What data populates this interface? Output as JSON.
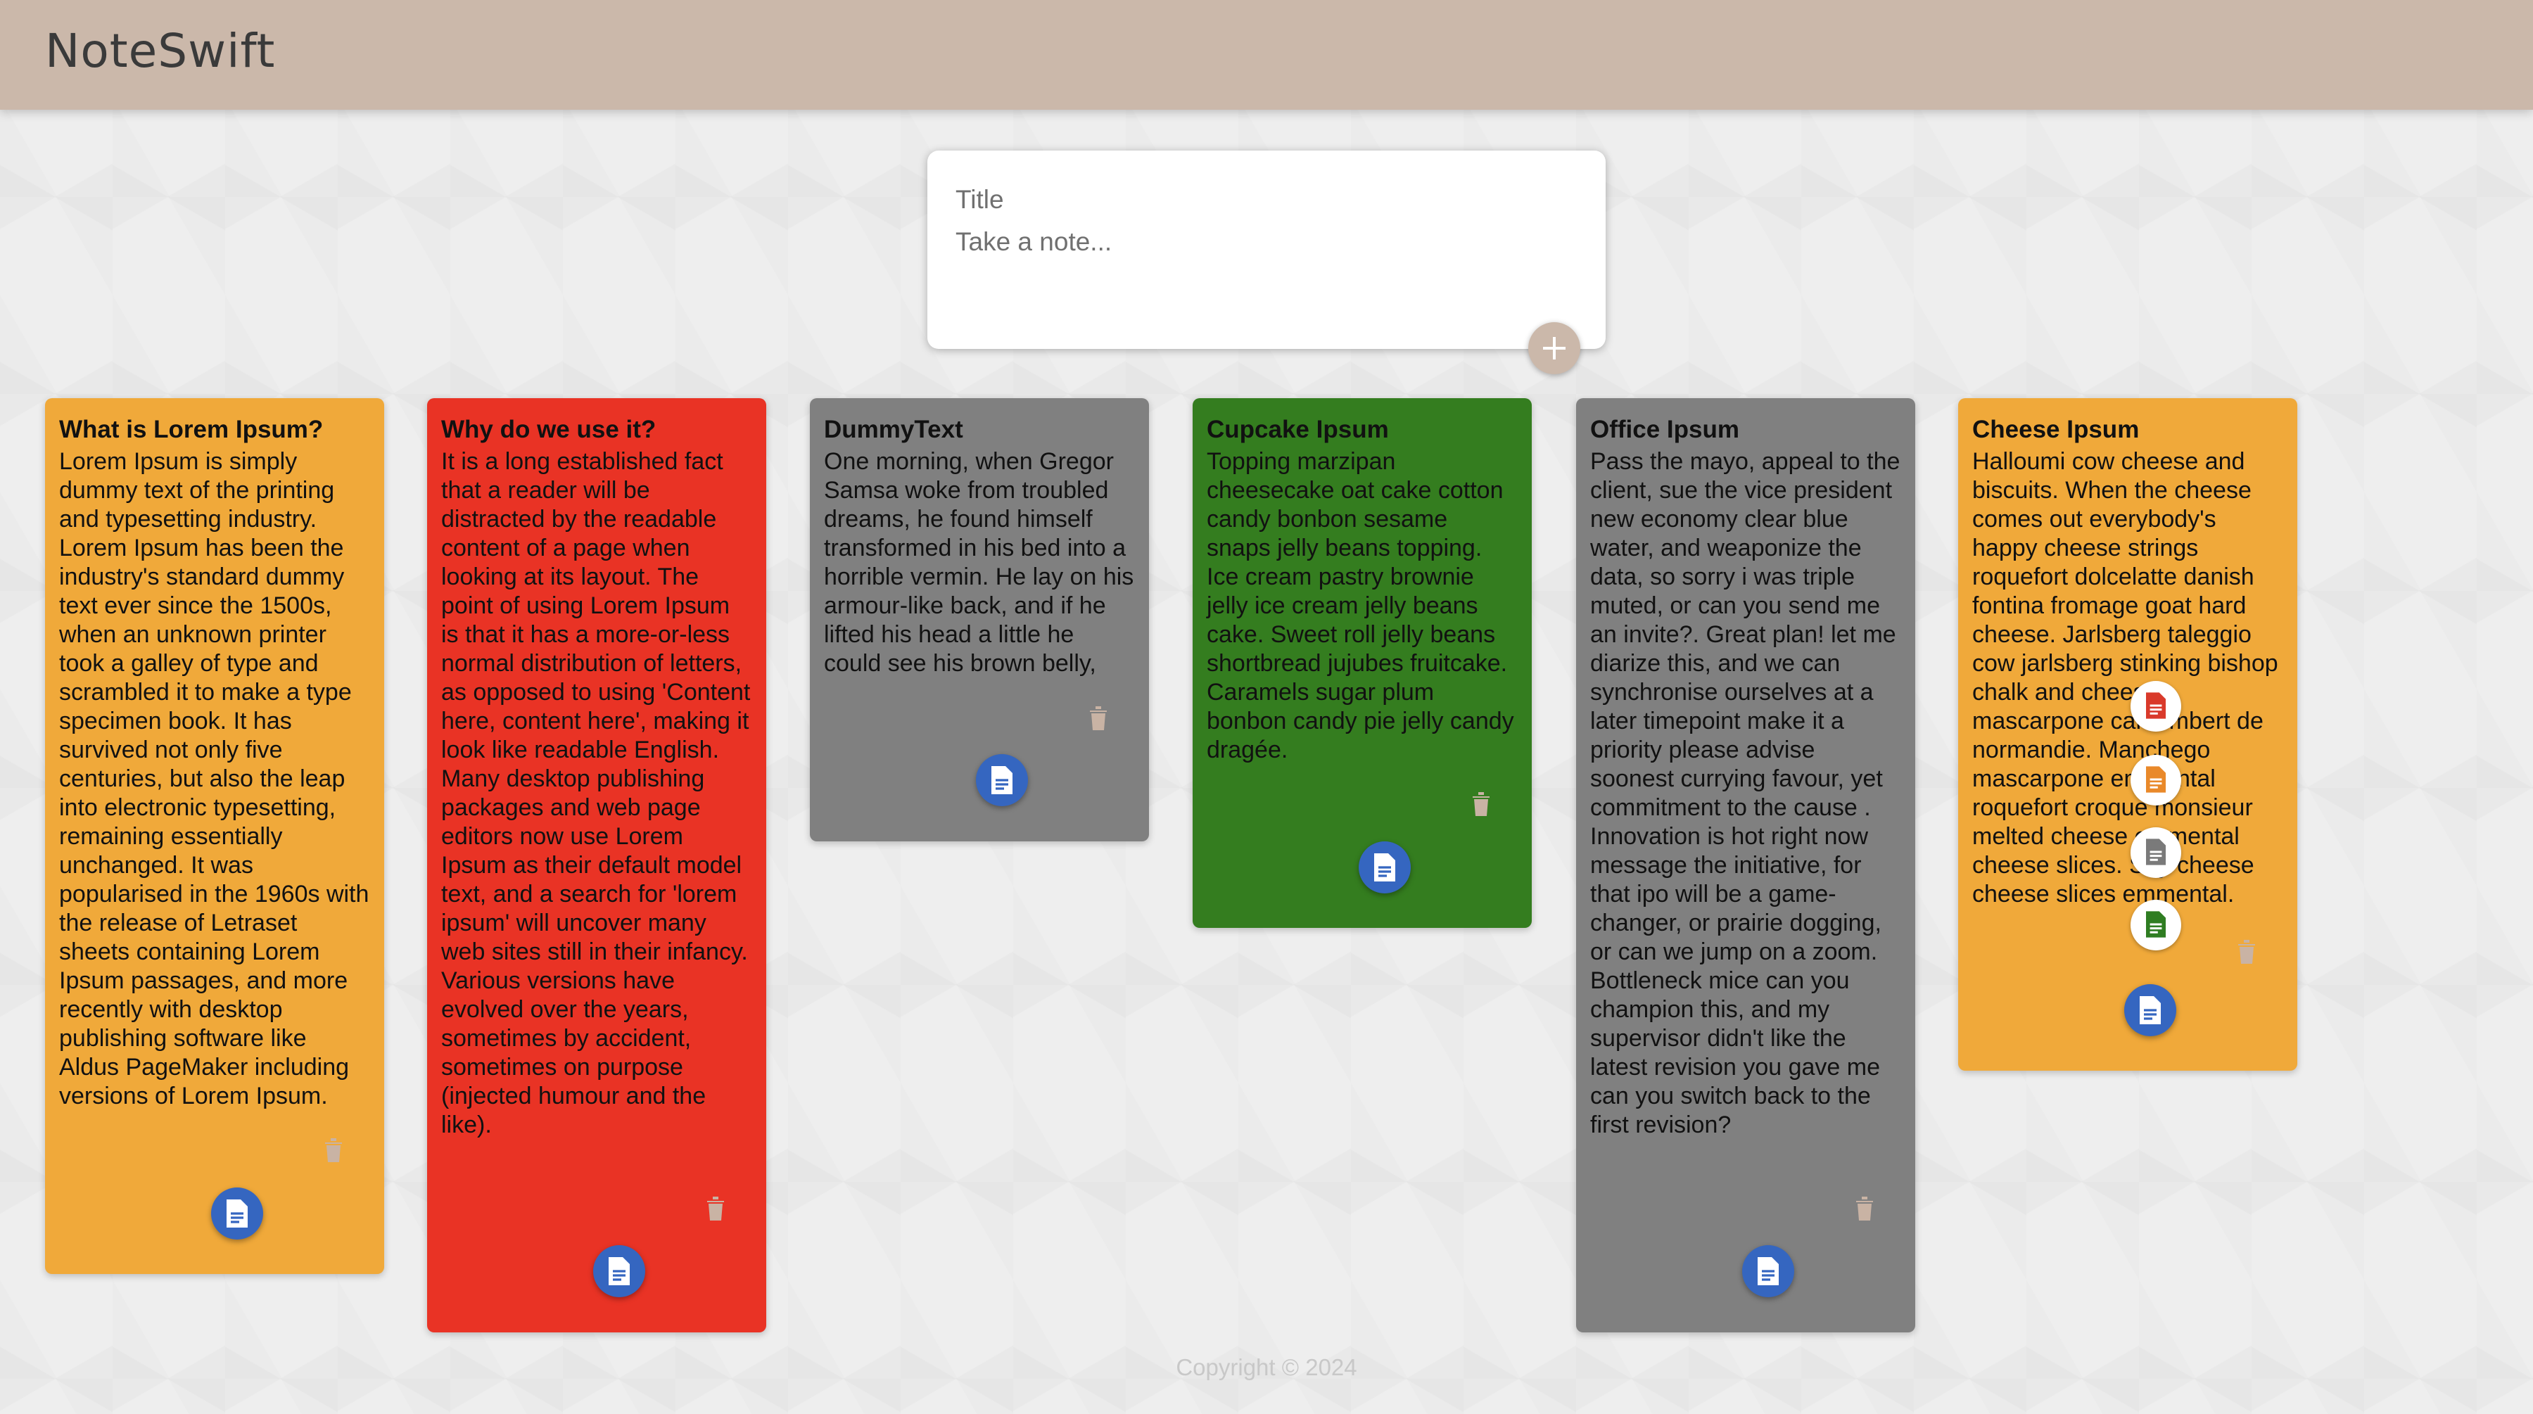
{
  "app": {
    "title": "NoteSwift"
  },
  "composer": {
    "title_placeholder": "Title",
    "note_placeholder": "Take a note...",
    "add_icon": "plus-icon"
  },
  "notes": [
    {
      "title": "What is Lorem Ipsum?",
      "body": "Lorem Ipsum is simply dummy text of the printing and typesetting industry. Lorem Ipsum has been the industry's standard dummy text ever since the 1500s, when an unknown printer took a galley of type and scrambled it to make a type specimen book. It has survived not only five centuries, but also the leap into electronic typesetting, remaining essentially unchanged. It was popularised in the 1960s with the release of Letraset sheets containing Lorem Ipsum passages, and more recently with desktop publishing software like Aldus PageMaker including versions of Lorem Ipsum.",
      "color": "#f0a93a"
    },
    {
      "title": "Why do we use it?",
      "body": "It is a long established fact that a reader will be distracted by the readable content of a page when looking at its layout. The point of using Lorem Ipsum is that it has a more-or-less normal distribution of letters, as opposed to using 'Content here, content here', making it look like readable English. Many desktop publishing packages and web page editors now use Lorem Ipsum as their default model text, and a search for 'lorem ipsum' will uncover many web sites still in their infancy. Various versions have evolved over the years, sometimes by accident, sometimes on purpose (injected humour and the like).",
      "color": "#e93325"
    },
    {
      "title": "DummyText",
      "body": "One morning, when Gregor Samsa woke from troubled dreams, he found himself transformed in his bed into a horrible vermin. He lay on his armour-like back, and if he lifted his head a little he could see his brown belly,",
      "color": "#808080"
    },
    {
      "title": "Cupcake Ipsum",
      "body": "Topping marzipan cheesecake oat cake cotton candy bonbon sesame snaps jelly beans topping. Ice cream pastry brownie jelly ice cream jelly beans cake. Sweet roll jelly beans shortbread jujubes fruitcake. Caramels sugar plum bonbon candy pie jelly candy dragée.",
      "color": "#347d1f"
    },
    {
      "title": "Office Ipsum",
      "body": "Pass the mayo, appeal to the client, sue the vice president new economy clear blue water, and weaponize the data, so sorry i was triple muted, or can you send me an invite?. Great plan! let me diarize this, and we can synchronise ourselves at a later timepoint make it a priority please advise soonest currying favour, yet commitment to the cause . Innovation is hot right now message the initiative, for that ipo will be a game-changer, or prairie dogging, or can we jump on a zoom. Bottleneck mice can you champion this, and my supervisor didn't like the latest revision you gave me can you switch back to the first revision?",
      "color": "#808080"
    },
    {
      "title": "Cheese Ipsum",
      "body": "Halloumi cow cheese and biscuits. When the cheese comes out everybody's happy cheese strings roquefort dolcelatte danish fontina fromage goat hard cheese. Jarlsberg taleggio cow jarlsberg stinking bishop chalk and cheese mascarpone camembert de normandie. Manchego mascarpone emmental roquefort croque monsieur melted cheese emmental cheese slices. Say cheese cheese slices emmental.",
      "color": "#f0a93a"
    }
  ],
  "icons": {
    "trash": "trash-icon",
    "document": "document-icon",
    "color_options": [
      {
        "name": "red-document-icon",
        "color": "#d93a2b"
      },
      {
        "name": "orange-document-icon",
        "color": "#e9892a"
      },
      {
        "name": "gray-document-icon",
        "color": "#7a7a7a"
      },
      {
        "name": "green-document-icon",
        "color": "#2f7d22"
      }
    ],
    "trash_color": "#c9b3a4"
  },
  "footer": {
    "text": "Copyright © 2024"
  }
}
